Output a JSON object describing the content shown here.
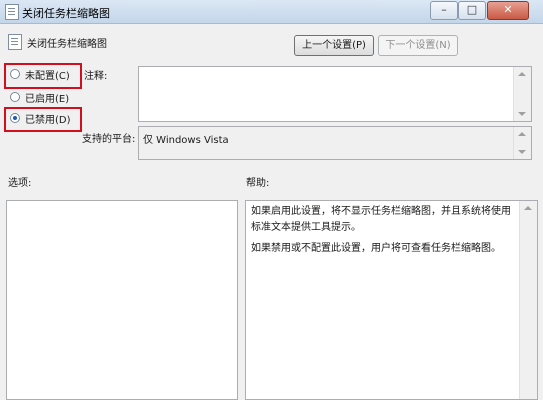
{
  "window": {
    "title": "关闭任务栏缩略图",
    "minimize": "–",
    "maximize": "□",
    "close": "✕"
  },
  "header": {
    "title": "关闭任务栏缩略图"
  },
  "nav": {
    "prev": "上一个设置(P)",
    "next": "下一个设置(N)"
  },
  "radios": [
    {
      "label": "未配置(C)",
      "checked": false
    },
    {
      "label": "已启用(E)",
      "checked": false
    },
    {
      "label": "已禁用(D)",
      "checked": true
    }
  ],
  "comment": {
    "label": "注释:",
    "value": ""
  },
  "platform": {
    "label": "支持的平台:",
    "value": "仅 Windows Vista"
  },
  "options": {
    "label": "选项:"
  },
  "help": {
    "label": "帮助:",
    "paragraphs": [
      "如果启用此设置，将不显示任务栏缩略图，并且系统将使用标准文本提供工具提示。",
      "如果禁用或不配置此设置，用户将可查看任务栏缩略图。"
    ]
  },
  "colors": {
    "highlight": "#d10f1f"
  }
}
